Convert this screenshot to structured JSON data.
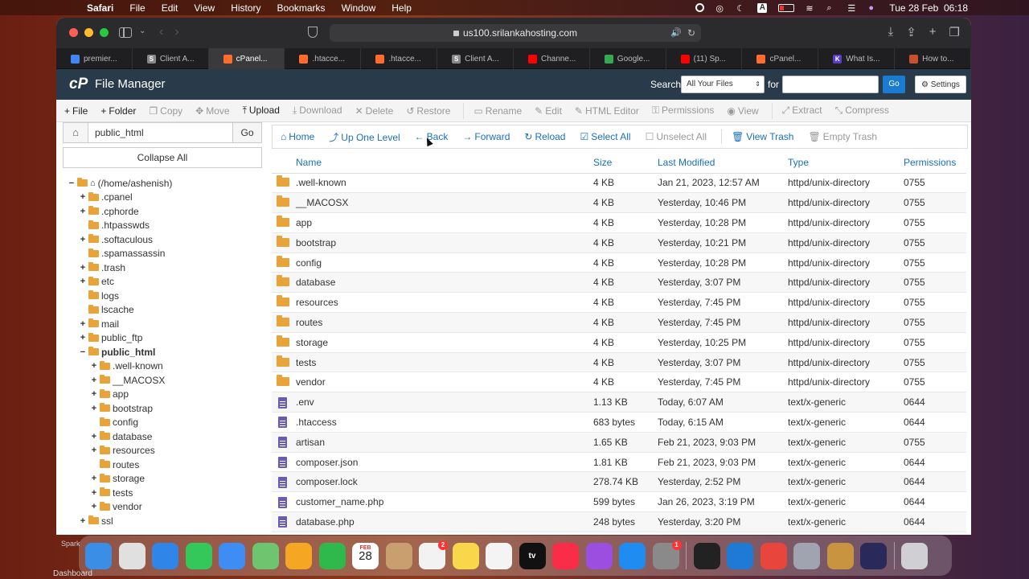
{
  "menubar": {
    "app": "Safari",
    "menus": [
      "File",
      "Edit",
      "View",
      "History",
      "Bookmarks",
      "Window",
      "Help"
    ],
    "clock": "Tue 28 Feb  06:18",
    "input_badge": "A"
  },
  "browser": {
    "url": "us100.srilankahosting.com",
    "tabs": [
      {
        "label": "premier...",
        "color": "#4285f4"
      },
      {
        "label": "Client A...",
        "color": "#888888",
        "glyph": "S"
      },
      {
        "label": "cPanel...",
        "color": "#ff6c2c",
        "active": true
      },
      {
        "label": ".htacce...",
        "color": "#ff6c2c"
      },
      {
        "label": ".htacce...",
        "color": "#ff6c2c"
      },
      {
        "label": "Client A...",
        "color": "#888888",
        "glyph": "S"
      },
      {
        "label": "Channe...",
        "color": "#ff0000"
      },
      {
        "label": "Google...",
        "color": "#34a853"
      },
      {
        "label": "(11) Sp...",
        "color": "#ff0000"
      },
      {
        "label": "cPanel...",
        "color": "#ff6c2c"
      },
      {
        "label": "What Is...",
        "color": "#5b3ec8",
        "glyph": "K"
      },
      {
        "label": "How to...",
        "color": "#c8502c"
      }
    ]
  },
  "header": {
    "title": "File Manager",
    "search_label": "Search",
    "search_scope": "All Your Files",
    "for_label": "for",
    "go_label": "Go",
    "settings_label": "Settings"
  },
  "actions": [
    {
      "label": "File",
      "icon": "+",
      "on": true
    },
    {
      "label": "Folder",
      "icon": "+",
      "on": true
    },
    {
      "label": "Copy",
      "icon": "❐",
      "on": false
    },
    {
      "label": "Move",
      "icon": "✥",
      "on": false
    },
    {
      "label": "Upload",
      "icon": "⤒",
      "on": true
    },
    {
      "label": "Download",
      "icon": "⤓",
      "on": false
    },
    {
      "label": "Delete",
      "icon": "✕",
      "on": false
    },
    {
      "label": "Restore",
      "icon": "↺",
      "on": false
    },
    {
      "label": "Rename",
      "icon": "▭",
      "on": false
    },
    {
      "label": "Edit",
      "icon": "✎",
      "on": false
    },
    {
      "label": "HTML Editor",
      "icon": "✎",
      "on": false
    },
    {
      "label": "Permissions",
      "icon": "⚿",
      "on": false
    },
    {
      "label": "View",
      "icon": "◉",
      "on": false
    },
    {
      "label": "Extract",
      "icon": "⤢",
      "on": false
    },
    {
      "label": "Compress",
      "icon": "⤡",
      "on": false
    }
  ],
  "left": {
    "path": "public_html",
    "go_label": "Go",
    "collapse_label": "Collapse All",
    "tree": [
      {
        "label": "(/home/ashenish)",
        "depth": 0,
        "toggle": "−",
        "home": true
      },
      {
        "label": ".cpanel",
        "depth": 1,
        "toggle": "+"
      },
      {
        "label": ".cphorde",
        "depth": 1,
        "toggle": "+"
      },
      {
        "label": ".htpasswds",
        "depth": 1,
        "toggle": ""
      },
      {
        "label": ".softaculous",
        "depth": 1,
        "toggle": "+"
      },
      {
        "label": ".spamassassin",
        "depth": 1,
        "toggle": ""
      },
      {
        "label": ".trash",
        "depth": 1,
        "toggle": "+"
      },
      {
        "label": "etc",
        "depth": 1,
        "toggle": "+"
      },
      {
        "label": "logs",
        "depth": 1,
        "toggle": ""
      },
      {
        "label": "lscache",
        "depth": 1,
        "toggle": ""
      },
      {
        "label": "mail",
        "depth": 1,
        "toggle": "+"
      },
      {
        "label": "public_ftp",
        "depth": 1,
        "toggle": "+"
      },
      {
        "label": "public_html",
        "depth": 1,
        "toggle": "−",
        "bold": true
      },
      {
        "label": ".well-known",
        "depth": 2,
        "toggle": "+"
      },
      {
        "label": "__MACOSX",
        "depth": 2,
        "toggle": "+"
      },
      {
        "label": "app",
        "depth": 2,
        "toggle": "+"
      },
      {
        "label": "bootstrap",
        "depth": 2,
        "toggle": "+"
      },
      {
        "label": "config",
        "depth": 2,
        "toggle": ""
      },
      {
        "label": "database",
        "depth": 2,
        "toggle": "+"
      },
      {
        "label": "resources",
        "depth": 2,
        "toggle": "+"
      },
      {
        "label": "routes",
        "depth": 2,
        "toggle": ""
      },
      {
        "label": "storage",
        "depth": 2,
        "toggle": "+"
      },
      {
        "label": "tests",
        "depth": 2,
        "toggle": "+"
      },
      {
        "label": "vendor",
        "depth": 2,
        "toggle": "+"
      },
      {
        "label": "ssl",
        "depth": 1,
        "toggle": "+"
      }
    ]
  },
  "nav": [
    {
      "label": "Home",
      "icon": "⌂",
      "on": true
    },
    {
      "label": "Up One Level",
      "icon": "⤴",
      "on": true
    },
    {
      "label": "Back",
      "icon": "←",
      "on": true
    },
    {
      "label": "Forward",
      "icon": "→",
      "on": true
    },
    {
      "label": "Reload",
      "icon": "↻",
      "on": true
    },
    {
      "label": "Select All",
      "icon": "☑",
      "on": true
    },
    {
      "label": "Unselect All",
      "icon": "☐",
      "on": false
    },
    {
      "label": "View Trash",
      "icon": "🗑",
      "on": true
    },
    {
      "label": "Empty Trash",
      "icon": "🗑",
      "on": false
    }
  ],
  "table": {
    "headers": [
      "Name",
      "Size",
      "Last Modified",
      "Type",
      "Permissions"
    ],
    "rows": [
      {
        "kind": "dir",
        "name": ".well-known",
        "size": "4 KB",
        "modified": "Jan 21, 2023, 12:57 AM",
        "type": "httpd/unix-directory",
        "perms": "0755"
      },
      {
        "kind": "dir",
        "name": "__MACOSX",
        "size": "4 KB",
        "modified": "Yesterday, 10:46 PM",
        "type": "httpd/unix-directory",
        "perms": "0755"
      },
      {
        "kind": "dir",
        "name": "app",
        "size": "4 KB",
        "modified": "Yesterday, 10:28 PM",
        "type": "httpd/unix-directory",
        "perms": "0755"
      },
      {
        "kind": "dir",
        "name": "bootstrap",
        "size": "4 KB",
        "modified": "Yesterday, 10:21 PM",
        "type": "httpd/unix-directory",
        "perms": "0755"
      },
      {
        "kind": "dir",
        "name": "config",
        "size": "4 KB",
        "modified": "Yesterday, 10:28 PM",
        "type": "httpd/unix-directory",
        "perms": "0755"
      },
      {
        "kind": "dir",
        "name": "database",
        "size": "4 KB",
        "modified": "Yesterday, 3:07 PM",
        "type": "httpd/unix-directory",
        "perms": "0755"
      },
      {
        "kind": "dir",
        "name": "resources",
        "size": "4 KB",
        "modified": "Yesterday, 7:45 PM",
        "type": "httpd/unix-directory",
        "perms": "0755"
      },
      {
        "kind": "dir",
        "name": "routes",
        "size": "4 KB",
        "modified": "Yesterday, 7:45 PM",
        "type": "httpd/unix-directory",
        "perms": "0755"
      },
      {
        "kind": "dir",
        "name": "storage",
        "size": "4 KB",
        "modified": "Yesterday, 10:25 PM",
        "type": "httpd/unix-directory",
        "perms": "0755"
      },
      {
        "kind": "dir",
        "name": "tests",
        "size": "4 KB",
        "modified": "Yesterday, 3:07 PM",
        "type": "httpd/unix-directory",
        "perms": "0755"
      },
      {
        "kind": "dir",
        "name": "vendor",
        "size": "4 KB",
        "modified": "Yesterday, 7:45 PM",
        "type": "httpd/unix-directory",
        "perms": "0755"
      },
      {
        "kind": "file",
        "name": ".env",
        "size": "1.13 KB",
        "modified": "Today, 6:07 AM",
        "type": "text/x-generic",
        "perms": "0644"
      },
      {
        "kind": "file",
        "name": ".htaccess",
        "size": "683 bytes",
        "modified": "Today, 6:15 AM",
        "type": "text/x-generic",
        "perms": "0644"
      },
      {
        "kind": "file",
        "name": "artisan",
        "size": "1.65 KB",
        "modified": "Feb 21, 2023, 9:03 PM",
        "type": "text/x-generic",
        "perms": "0755"
      },
      {
        "kind": "file",
        "name": "composer.json",
        "size": "1.81 KB",
        "modified": "Feb 21, 2023, 9:03 PM",
        "type": "text/x-generic",
        "perms": "0644"
      },
      {
        "kind": "file",
        "name": "composer.lock",
        "size": "278.74 KB",
        "modified": "Yesterday, 2:52 PM",
        "type": "text/x-generic",
        "perms": "0644"
      },
      {
        "kind": "file",
        "name": "customer_name.php",
        "size": "599 bytes",
        "modified": "Jan 26, 2023, 3:19 PM",
        "type": "text/x-generic",
        "perms": "0644"
      },
      {
        "kind": "file",
        "name": "database.php",
        "size": "248 bytes",
        "modified": "Yesterday, 3:20 PM",
        "type": "text/x-generic",
        "perms": "0644"
      }
    ]
  },
  "dock": {
    "items": [
      {
        "name": "finder-icon",
        "color": "#3a8ee6"
      },
      {
        "name": "launchpad-icon",
        "color": "#e0e0e0"
      },
      {
        "name": "safari-icon",
        "color": "#2f86e8"
      },
      {
        "name": "messages-icon",
        "color": "#34c759"
      },
      {
        "name": "mail-icon",
        "color": "#3d8df5"
      },
      {
        "name": "maps-icon",
        "color": "#6fc46f"
      },
      {
        "name": "photos-icon",
        "color": "#f5a623"
      },
      {
        "name": "facetime-icon",
        "color": "#2fb84b"
      },
      {
        "name": "calendar-icon",
        "color": "#ffffff",
        "glyph": "28",
        "month": "FEB"
      },
      {
        "name": "contacts-icon",
        "color": "#c8a070"
      },
      {
        "name": "reminders-icon",
        "color": "#f2f2f2",
        "badge": "2"
      },
      {
        "name": "notes-icon",
        "color": "#f8d74a"
      },
      {
        "name": "freeform-icon",
        "color": "#f4f4f4"
      },
      {
        "name": "tv-icon",
        "color": "#111111",
        "glyph": "tv"
      },
      {
        "name": "music-icon",
        "color": "#fa2d48"
      },
      {
        "name": "podcasts-icon",
        "color": "#9b4ee0"
      },
      {
        "name": "app-store-icon",
        "color": "#1e8cf0"
      },
      {
        "name": "system-settings-icon",
        "color": "#8a8a8a",
        "badge": "1"
      },
      {
        "name": "terminal-icon",
        "color": "#222222"
      },
      {
        "name": "vscode-icon",
        "color": "#1f7ad6"
      },
      {
        "name": "chrome-icon",
        "color": "#e8453c"
      },
      {
        "name": "preferences-gear-icon",
        "color": "#a0a4b0"
      },
      {
        "name": "cocktail-icon",
        "color": "#c89440"
      },
      {
        "name": "screen-recorder-icon",
        "color": "#2a2a5a"
      },
      {
        "name": "trash-icon",
        "color": "#cfcfd4"
      }
    ],
    "dash_label": "Dashboard",
    "sparkle_label": "Spark"
  }
}
